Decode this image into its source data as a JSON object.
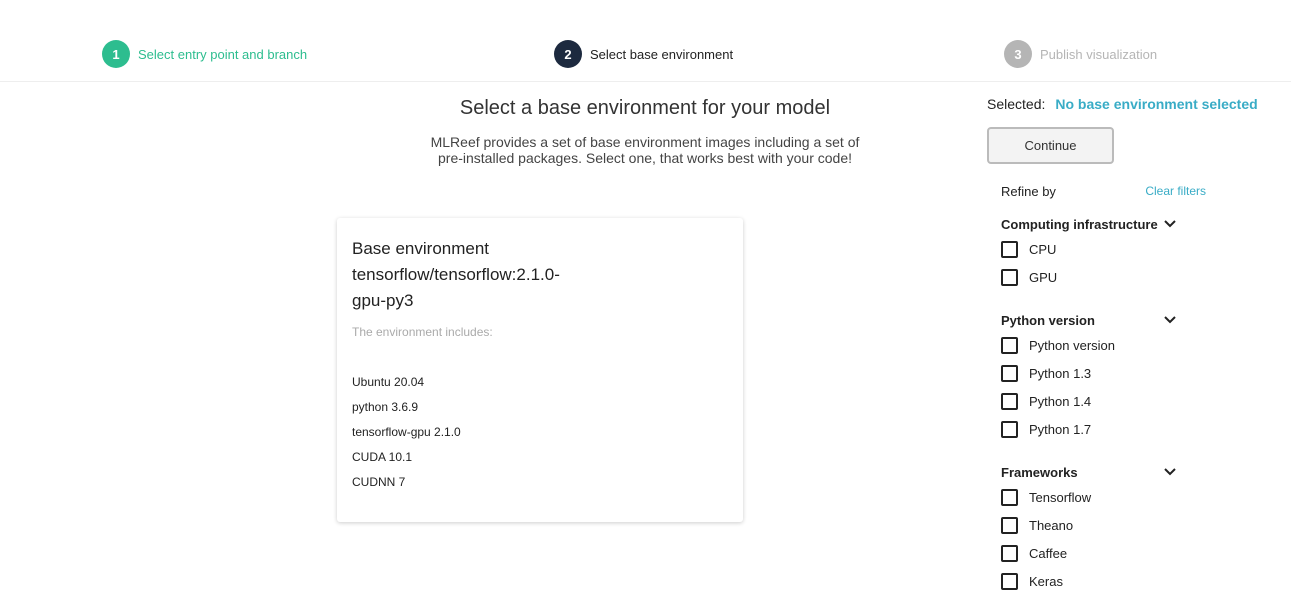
{
  "steps": [
    {
      "num": "1",
      "label": "Select entry point and branch"
    },
    {
      "num": "2",
      "label": "Select base environment"
    },
    {
      "num": "3",
      "label": "Publish visualization"
    }
  ],
  "main": {
    "title": "Select a base environment for your model",
    "description": "MLReef provides a set of base environment images including a set of pre-installed packages. Select one, that works best with your code!"
  },
  "card": {
    "title": "Base environment tensorflow/tensorflow:2.1.0-gpu-py3",
    "includes_label": "The environment includes:",
    "packages": [
      "Ubuntu 20.04",
      "python 3.6.9",
      "tensorflow-gpu 2.1.0",
      "CUDA 10.1",
      "CUDNN 7"
    ]
  },
  "sidebar": {
    "selected_label": "Selected:",
    "selected_value": "No base environment selected",
    "continue_label": "Continue",
    "refine_label": "Refine by",
    "clear_label": "Clear filters",
    "groups": [
      {
        "title": "Computing infrastructure",
        "options": [
          "CPU",
          "GPU"
        ]
      },
      {
        "title": "Python version",
        "options": [
          "Python version",
          "Python 1.3",
          "Python 1.4",
          "Python 1.7"
        ]
      },
      {
        "title": "Frameworks",
        "options": [
          "Tensorflow",
          "Theano",
          "Caffee",
          "Keras"
        ]
      }
    ]
  }
}
